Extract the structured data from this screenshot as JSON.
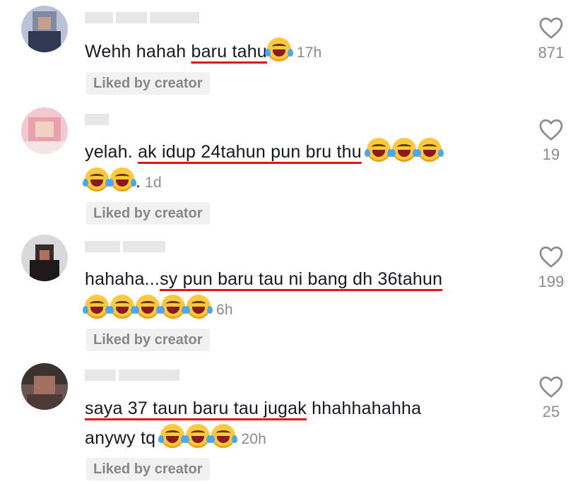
{
  "comments": [
    {
      "text_before": "Wehh hahah ",
      "underlined": "baru tahu",
      "text_after": "",
      "line2_prefix": "",
      "emojis_inline": 1,
      "emojis_line2": 0,
      "time": "17h",
      "badge": "Liked by creator",
      "likes": "871",
      "emoji_icon": "face-with-tears-of-joy"
    },
    {
      "text_before": "yelah. ",
      "underlined": "ak idup 24tahun pun bru thu",
      "text_after": " ",
      "line2_suffix": ".",
      "emojis_inline": 3,
      "emojis_line2": 2,
      "time": "1d",
      "badge": "Liked by creator",
      "likes": "19",
      "emoji_icon": "face-with-tears-of-joy"
    },
    {
      "text_before": "hahaha...",
      "underlined": "sy pun baru tau ni bang dh 36tahun",
      "text_after": "",
      "emojis_line2": 5,
      "time": "6h",
      "badge": "Liked by creator",
      "likes": "199",
      "emoji_icon": "face-with-tears-of-joy"
    },
    {
      "text_before": "",
      "underlined": "saya 37 taun baru tau jugak",
      "text_after": " hhahhahahha",
      "line2_text": "anywy tq ",
      "emojis_line2": 3,
      "time": "20h",
      "badge": "Liked by creator",
      "likes": "25",
      "emoji_icon": "face-with-tears-of-joy"
    }
  ],
  "icons": {
    "like": "heart-outline-icon"
  },
  "colors": {
    "underline": "#e01616",
    "badge_bg": "#f1f1f2",
    "muted": "#8a8b91"
  }
}
